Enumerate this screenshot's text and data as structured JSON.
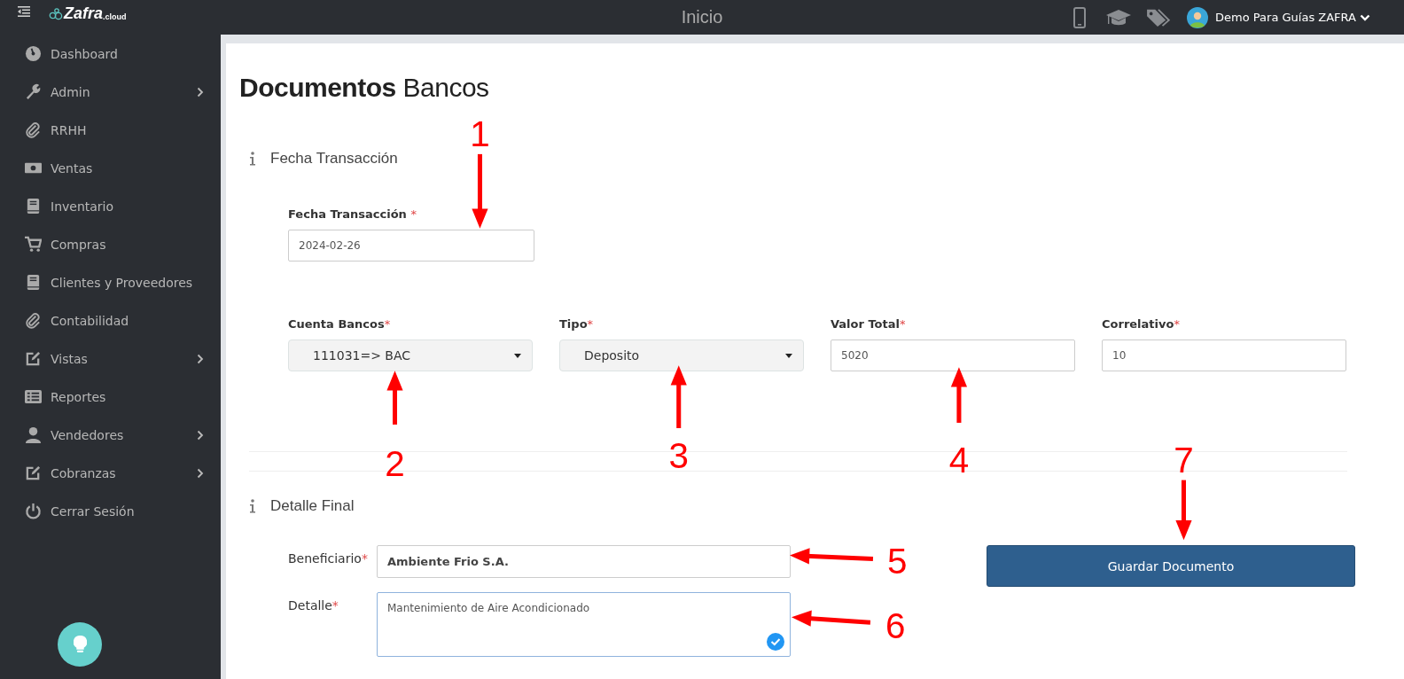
{
  "topbar": {
    "logo": "Zafra",
    "logo_suffix": ".cloud",
    "title": "Inicio",
    "user": "Demo Para Guías ZAFRA"
  },
  "sidebar": {
    "items": [
      {
        "label": "Dashboard",
        "has_submenu": false
      },
      {
        "label": "Admin",
        "has_submenu": true
      },
      {
        "label": "RRHH",
        "has_submenu": false
      },
      {
        "label": "Ventas",
        "has_submenu": false
      },
      {
        "label": "Inventario",
        "has_submenu": false
      },
      {
        "label": "Compras",
        "has_submenu": false
      },
      {
        "label": "Clientes y Proveedores",
        "has_submenu": false
      },
      {
        "label": "Contabilidad",
        "has_submenu": false
      },
      {
        "label": "Vistas",
        "has_submenu": true
      },
      {
        "label": "Reportes",
        "has_submenu": false
      },
      {
        "label": "Vendedores",
        "has_submenu": true
      },
      {
        "label": "Cobranzas",
        "has_submenu": true
      },
      {
        "label": "Cerrar Sesión",
        "has_submenu": false
      }
    ]
  },
  "page": {
    "title": "**Documentos** Bancos",
    "required_mark": "*",
    "transaction": {
      "heading": "Fecha Transacción",
      "date_field": {
        "label": "Fecha Transacción",
        "kind": "text",
        "value": "2024-02-26",
        "required": true
      },
      "fields": [
        {
          "label": "Cuenta Bancos",
          "kind": "select",
          "value": "111031=> BAC",
          "required": true
        },
        {
          "label": "Tipo",
          "kind": "select",
          "value": "Deposito",
          "required": true
        },
        {
          "label": "Valor Total",
          "kind": "text",
          "value": "5020",
          "required": true
        },
        {
          "label": "Correlativo",
          "kind": "text",
          "value": "10",
          "required": true
        }
      ]
    },
    "final": {
      "heading": "Detalle Final",
      "fields": [
        {
          "label": "Beneficiario",
          "kind": "text",
          "value": "Ambiente Frio S.A.",
          "required": true
        },
        {
          "label": "Detalle",
          "kind": "textarea",
          "value": "Mantenimiento de Aire Acondicionado",
          "required": true,
          "focused": true,
          "valid": true
        }
      ],
      "save_button": "Guardar Documento"
    }
  },
  "annotations": [
    {
      "number": "1"
    },
    {
      "number": "2"
    },
    {
      "number": "3"
    },
    {
      "number": "4"
    },
    {
      "number": "5"
    },
    {
      "number": "6"
    },
    {
      "number": "7"
    }
  ]
}
